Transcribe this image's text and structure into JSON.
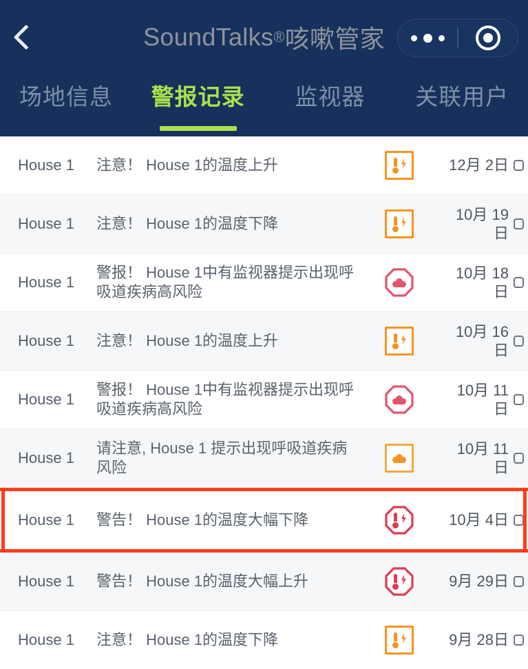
{
  "header": {
    "back_icon": "chevron-left-icon",
    "title_main": "SoundTalks",
    "title_reg": "®",
    "title_cn": "咳嗽管家",
    "menu_icon": "more-dots-icon",
    "close_icon": "target-circle-icon"
  },
  "tabs": [
    {
      "label": "场地信息",
      "active": false
    },
    {
      "label": "警报记录",
      "active": true
    },
    {
      "label": "监视器",
      "active": false
    },
    {
      "label": "关联用户",
      "active": false
    }
  ],
  "colors": {
    "header_bg": "#17315c",
    "tab_active": "#a8e04c",
    "tab_underline": "#aee04e",
    "tab_inactive": "#7e8fa8",
    "row_alt_bg": "#f6f7f8",
    "highlight_border": "#ff3d1c",
    "icon_orange": "#f79321",
    "icon_red": "#e03a52",
    "icon_pink": "#e2556e"
  },
  "alerts": [
    {
      "house": "House 1",
      "message": "注意！ House 1的温度上升",
      "icon": "temperature-bolt-orange-square-icon",
      "icon_kind": "square-orange",
      "date": "12月 2日",
      "date_wrap": false,
      "highlighted": false
    },
    {
      "house": "House 1",
      "message": "注意！ House 1的温度下降",
      "icon": "temperature-bolt-orange-square-icon",
      "icon_kind": "square-orange",
      "date": "10月 19日",
      "date_wrap": true,
      "highlighted": false
    },
    {
      "house": "House 1",
      "message": "警报！ House 1中有监视器提示出现呼吸道疾病高风险",
      "icon": "respiratory-risk-red-octagon-icon",
      "icon_kind": "octagon-lung-red",
      "date": "10月 18日",
      "date_wrap": true,
      "highlighted": false
    },
    {
      "house": "House 1",
      "message": "注意！ House 1的温度上升",
      "icon": "temperature-bolt-orange-square-icon",
      "icon_kind": "square-orange",
      "date": "10月 16日",
      "date_wrap": true,
      "highlighted": false
    },
    {
      "house": "House 1",
      "message": "警报！ House 1中有监视器提示出现呼吸道疾病高风险",
      "icon": "respiratory-risk-red-octagon-icon",
      "icon_kind": "octagon-lung-red",
      "date": "10月 11日",
      "date_wrap": true,
      "highlighted": false
    },
    {
      "house": "House 1",
      "message": "请注意, House 1 提示出现呼吸道疾病风险",
      "icon": "respiratory-risk-orange-square-icon",
      "icon_kind": "square-lung-orange",
      "date": "10月 11日",
      "date_wrap": true,
      "highlighted": false
    },
    {
      "house": "House 1",
      "message": "警告！ House 1的温度大幅下降",
      "icon": "temperature-bolt-red-octagon-icon",
      "icon_kind": "octagon-temp-red",
      "date": "10月 4日",
      "date_wrap": false,
      "highlighted": true
    },
    {
      "house": "House 1",
      "message": "警告！ House 1的温度大幅上升",
      "icon": "temperature-bolt-red-octagon-icon",
      "icon_kind": "octagon-temp-red",
      "date": "9月 29日",
      "date_wrap": false,
      "highlighted": false
    },
    {
      "house": "House 1",
      "message": "注意！ House 1的温度下降",
      "icon": "temperature-bolt-orange-square-icon",
      "icon_kind": "square-orange",
      "date": "9月 28日",
      "date_wrap": false,
      "highlighted": false
    }
  ]
}
